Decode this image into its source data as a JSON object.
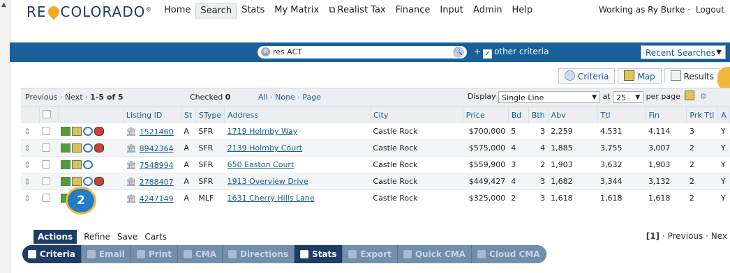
{
  "brand": {
    "name": "RE COLORADO",
    "reg_mark": "®"
  },
  "nav": [
    "Home",
    "Search",
    "Stats",
    "My Matrix",
    "Realist Tax",
    "Finance",
    "Input",
    "Admin",
    "Help"
  ],
  "user": {
    "working_as": "Working as Ry Burke ·",
    "logout": "Logout"
  },
  "search": {
    "query": "res ACT",
    "plus_label": "+",
    "other_criteria": "other criteria",
    "recent_label": "Recent Searches"
  },
  "view_tabs": {
    "criteria": "Criteria",
    "map": "Map",
    "results": "Results"
  },
  "controls": {
    "previous": "Previous",
    "next": "Next",
    "range": "1-5 of 5",
    "checked_label": "Checked",
    "checked_count": "0",
    "all": "All",
    "none": "None",
    "page": "Page",
    "display_label": "Display",
    "display_value": "Single Line",
    "at_label": "at",
    "per_page_value": "25",
    "per_page_label": "per page"
  },
  "columns": [
    "Listing ID",
    "St",
    "SType",
    "Address",
    "City",
    "Price",
    "Bd",
    "Bth",
    "Abv",
    "Ttl",
    "Fin",
    "Prk Ttl",
    "A"
  ],
  "rows": [
    {
      "id": "1521460",
      "st": "A",
      "stype": "SFR",
      "address": "1719 Holmby Way",
      "city": "Castle Rock",
      "price": "$700,000",
      "bd": "5",
      "bth": "3",
      "abv": "2,259",
      "ttl": "4,531",
      "fin": "4,114",
      "prk": "3",
      "extra": "Y"
    },
    {
      "id": "8942364",
      "st": "A",
      "stype": "SFR",
      "address": "2139 Holmby Court",
      "city": "Castle Rock",
      "price": "$575,000",
      "bd": "4",
      "bth": "4",
      "abv": "1,885",
      "ttl": "3,755",
      "fin": "3,007",
      "prk": "2",
      "extra": "Y"
    },
    {
      "id": "7548994",
      "st": "A",
      "stype": "SFR",
      "address": "650 Easton Court",
      "city": "Castle Rock",
      "price": "$559,900",
      "bd": "3",
      "bth": "2",
      "abv": "1,903",
      "ttl": "3,632",
      "fin": "1,903",
      "prk": "2",
      "extra": "Y"
    },
    {
      "id": "2788407",
      "st": "A",
      "stype": "SFR",
      "address": "1913 Overview Drive",
      "city": "Castle Rock",
      "price": "$449,427",
      "bd": "4",
      "bth": "3",
      "abv": "1,682",
      "ttl": "3,344",
      "fin": "3,132",
      "prk": "2",
      "extra": "Y"
    },
    {
      "id": "4247149",
      "st": "A",
      "stype": "MLF",
      "address": "1631 Cherry Hills Lane",
      "city": "Castle Rock",
      "price": "$325,000",
      "bd": "2",
      "bth": "3",
      "abv": "1,618",
      "ttl": "1,618",
      "fin": "1,618",
      "prk": "2",
      "extra": "Y"
    }
  ],
  "step_badge": "2",
  "action_tabs": [
    "Actions",
    "Refine",
    "Save",
    "Carts"
  ],
  "pager": {
    "current": "[1]",
    "previous": "· Previous ·",
    "next": "Nex"
  },
  "toolbar": [
    "Criteria",
    "Email",
    "Print",
    "CMA",
    "Directions",
    "Stats",
    "Export",
    "Quick CMA",
    "Cloud CMA"
  ],
  "colors": {
    "brand_blue": "#17609a",
    "dark_navy": "#1d3d66",
    "callout_gold": "#f1b838"
  }
}
